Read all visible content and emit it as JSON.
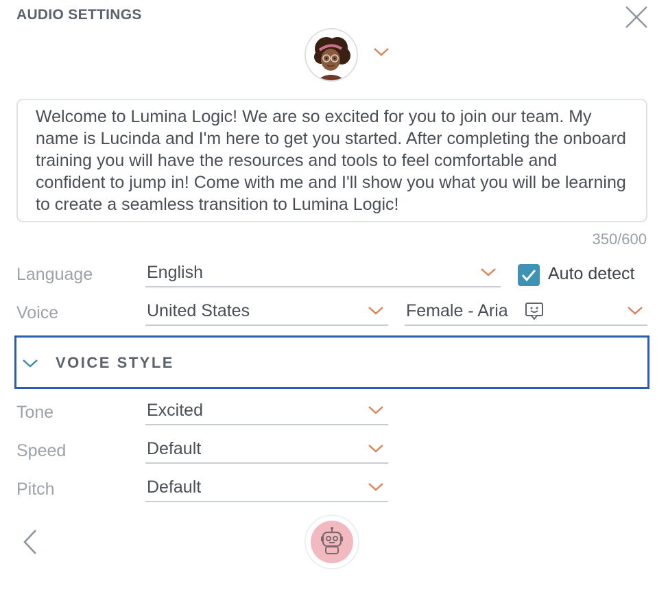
{
  "header": {
    "title": "AUDIO SETTINGS"
  },
  "icons": {
    "close": "close-icon",
    "avatar_dropdown": "chevron-down-icon",
    "back": "chevron-left-icon",
    "voice_preview": "robot-icon",
    "voice_sample": "speech-bubble-icon"
  },
  "script": {
    "text": "Welcome to Lumina Logic! We are so excited for you to join our team. My name is Lucinda and I'm here to get you started. After completing the onboard training you will have the resources and tools to feel comfortable and confident to jump in! Come with me and I'll show you what you will be learning to create a seamless transition to Lumina Logic!",
    "char_count": "350/600"
  },
  "language": {
    "label": "Language",
    "value": "English",
    "auto_detect_label": "Auto detect",
    "auto_detect_checked": true
  },
  "voice": {
    "label": "Voice",
    "region": "United States",
    "speaker": "Female - Aria"
  },
  "voice_style": {
    "label": "VOICE STYLE",
    "expanded": true
  },
  "tone": {
    "label": "Tone",
    "value": "Excited"
  },
  "speed": {
    "label": "Speed",
    "value": "Default"
  },
  "pitch": {
    "label": "Pitch",
    "value": "Default"
  },
  "colors": {
    "accent_chevron": "#d9825b",
    "checkbox": "#3d93b5",
    "focus_border": "#2d5cb3",
    "voice_style_chevron": "#3d8aa8",
    "robot_button": "#f3b9c0"
  }
}
